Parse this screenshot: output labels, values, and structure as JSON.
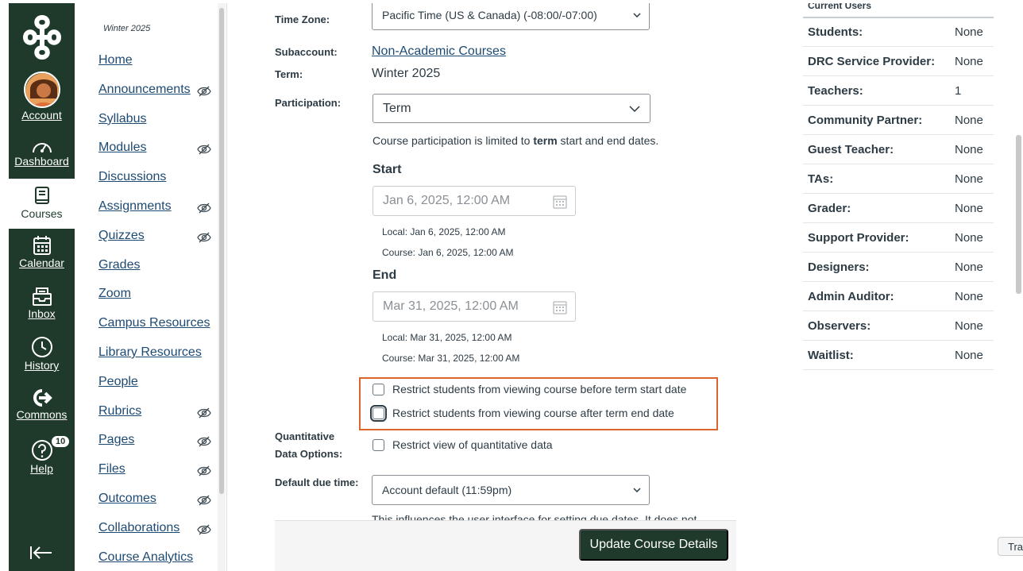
{
  "global_nav": {
    "account": "Account",
    "dashboard": "Dashboard",
    "courses": "Courses",
    "calendar": "Calendar",
    "inbox": "Inbox",
    "history": "History",
    "commons": "Commons",
    "help": "Help",
    "help_badge": "10"
  },
  "course_nav": {
    "term": "Winter 2025",
    "items": [
      {
        "label": "Home",
        "hidden": false
      },
      {
        "label": "Announcements",
        "hidden": true
      },
      {
        "label": "Syllabus",
        "hidden": false
      },
      {
        "label": "Modules",
        "hidden": true
      },
      {
        "label": "Discussions",
        "hidden": false
      },
      {
        "label": "Assignments",
        "hidden": true
      },
      {
        "label": "Quizzes",
        "hidden": true
      },
      {
        "label": "Grades",
        "hidden": false
      },
      {
        "label": "Zoom",
        "hidden": false
      },
      {
        "label": "Campus Resources",
        "hidden": false
      },
      {
        "label": "Library Resources",
        "hidden": false
      },
      {
        "label": "People",
        "hidden": false
      },
      {
        "label": "Rubrics",
        "hidden": true
      },
      {
        "label": "Pages",
        "hidden": true
      },
      {
        "label": "Files",
        "hidden": true
      },
      {
        "label": "Outcomes",
        "hidden": true
      },
      {
        "label": "Collaborations",
        "hidden": true
      },
      {
        "label": "Course Analytics",
        "hidden": false
      }
    ]
  },
  "form": {
    "time_zone_label": "Time Zone:",
    "time_zone_value": "Pacific Time (US & Canada) (-08:00/-07:00)",
    "subaccount_label": "Subaccount:",
    "subaccount_value": "Non-Academic Courses",
    "term_label": "Term:",
    "term_value": "Winter 2025",
    "participation_label": "Participation:",
    "participation_value": "Term",
    "participation_note_pre": "Course participation is limited to ",
    "participation_note_bold": "term",
    "participation_note_post": " start and end dates.",
    "start_heading": "Start",
    "start_date": "Jan 6, 2025, 12:00 AM",
    "start_local": "Local: Jan 6, 2025, 12:00 AM",
    "start_course": "Course: Jan 6, 2025, 12:00 AM",
    "end_heading": "End",
    "end_date": "Mar 31, 2025, 12:00 AM",
    "end_local": "Local: Mar 31, 2025, 12:00 AM",
    "end_course": "Course: Mar 31, 2025, 12:00 AM",
    "restrict_before": "Restrict students from viewing course before term start date",
    "restrict_after": "Restrict students from viewing course after term end date",
    "quant_label_1": "Quantitative",
    "quant_label_2": "Data Options:",
    "restrict_quant": "Restrict view of quantitative data",
    "due_time_label": "Default due time:",
    "due_time_value": "Account default (11:59pm)",
    "due_time_note": "This influences the user interface for setting due dates. It does not",
    "update_button": "Update Course Details"
  },
  "users": {
    "title": "Current Users",
    "rows": [
      {
        "k": "Students:",
        "v": "None"
      },
      {
        "k": "DRC Service Provider:",
        "v": "None"
      },
      {
        "k": "Teachers:",
        "v": "1"
      },
      {
        "k": "Community Partner:",
        "v": "None"
      },
      {
        "k": "Guest Teacher:",
        "v": "None"
      },
      {
        "k": "TAs:",
        "v": "None"
      },
      {
        "k": "Grader:",
        "v": "None"
      },
      {
        "k": "Support Provider:",
        "v": "None"
      },
      {
        "k": "Designers:",
        "v": "None"
      },
      {
        "k": "Admin Auditor:",
        "v": "None"
      },
      {
        "k": "Observers:",
        "v": "None"
      },
      {
        "k": "Waitlist:",
        "v": "None"
      }
    ]
  },
  "translate_tab": "Tra"
}
